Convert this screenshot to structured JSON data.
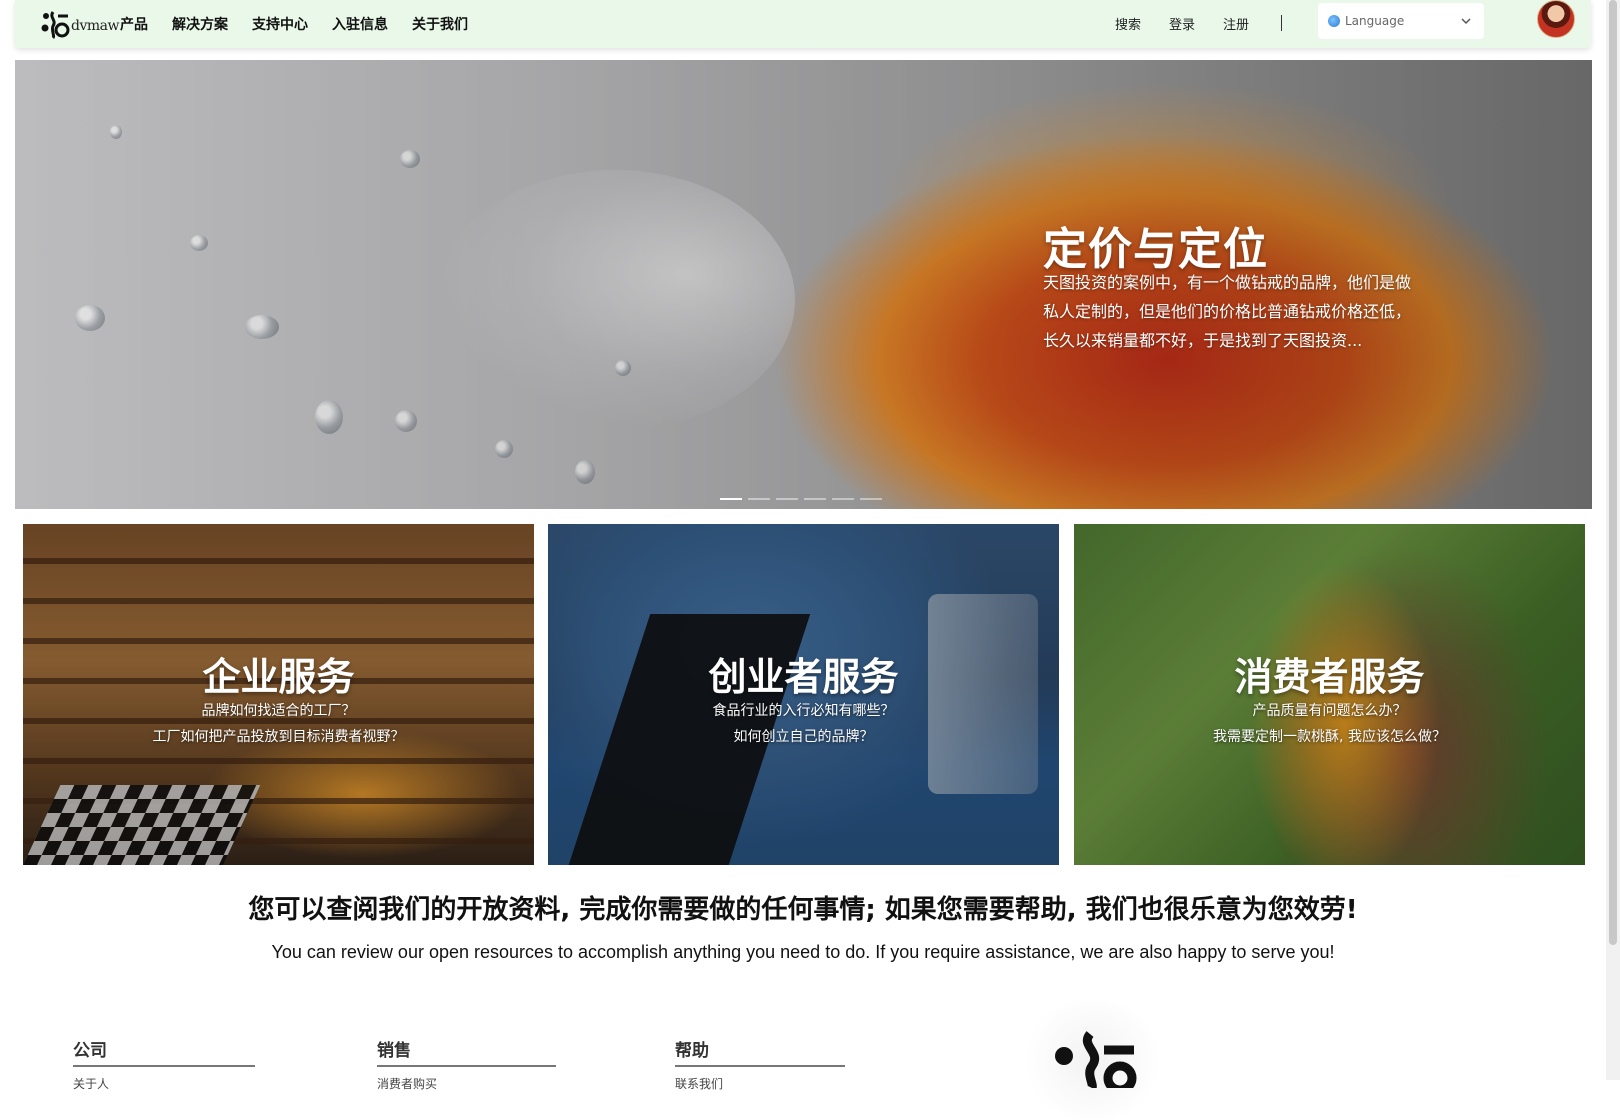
{
  "header": {
    "logo_text": "dvmaw",
    "nav": [
      "产品",
      "解决方案",
      "支持中心",
      "入驻信息",
      "关于我们"
    ],
    "links": {
      "search": "搜索",
      "login": "登录",
      "register": "注册"
    },
    "language_placeholder": "Language"
  },
  "hero": {
    "title": "定价与定位",
    "description": "天图投资的案例中，有一个做钻戒的品牌，他们是做私人定制的，但是他们的价格比普通钻戒价格还低，长久以来销量都不好，于是找到了天图投资...",
    "slide_count": 6,
    "active_slide": 1
  },
  "services": [
    {
      "title": "企业服务",
      "lines": [
        "品牌如何找适合的工厂？",
        "工厂如何把产品投放到目标消费者视野？"
      ]
    },
    {
      "title": "创业者服务",
      "lines": [
        "食品行业的入行必知有哪些？",
        "如何创立自己的品牌？"
      ]
    },
    {
      "title": "消费者服务",
      "lines": [
        "产品质量有问题怎么办？",
        "我需要定制一款桃酥, 我应该怎么做？"
      ]
    }
  ],
  "tagline": {
    "cn": "您可以查阅我们的开放资料, 完成你需要做的任何事情; 如果您需要帮助, 我们也很乐意为您效劳!",
    "en": "You can review our open resources to accomplish anything you need to do. If you require assistance, we are also happy to serve you!"
  },
  "footer": {
    "columns": [
      {
        "heading": "公司",
        "items": [
          "关于人"
        ]
      },
      {
        "heading": "销售",
        "items": [
          "消费者购买"
        ]
      },
      {
        "heading": "帮助",
        "items": [
          "联系我们"
        ]
      }
    ]
  },
  "colors": {
    "header_bg": "#e9f8e9",
    "accent": "#111111"
  }
}
